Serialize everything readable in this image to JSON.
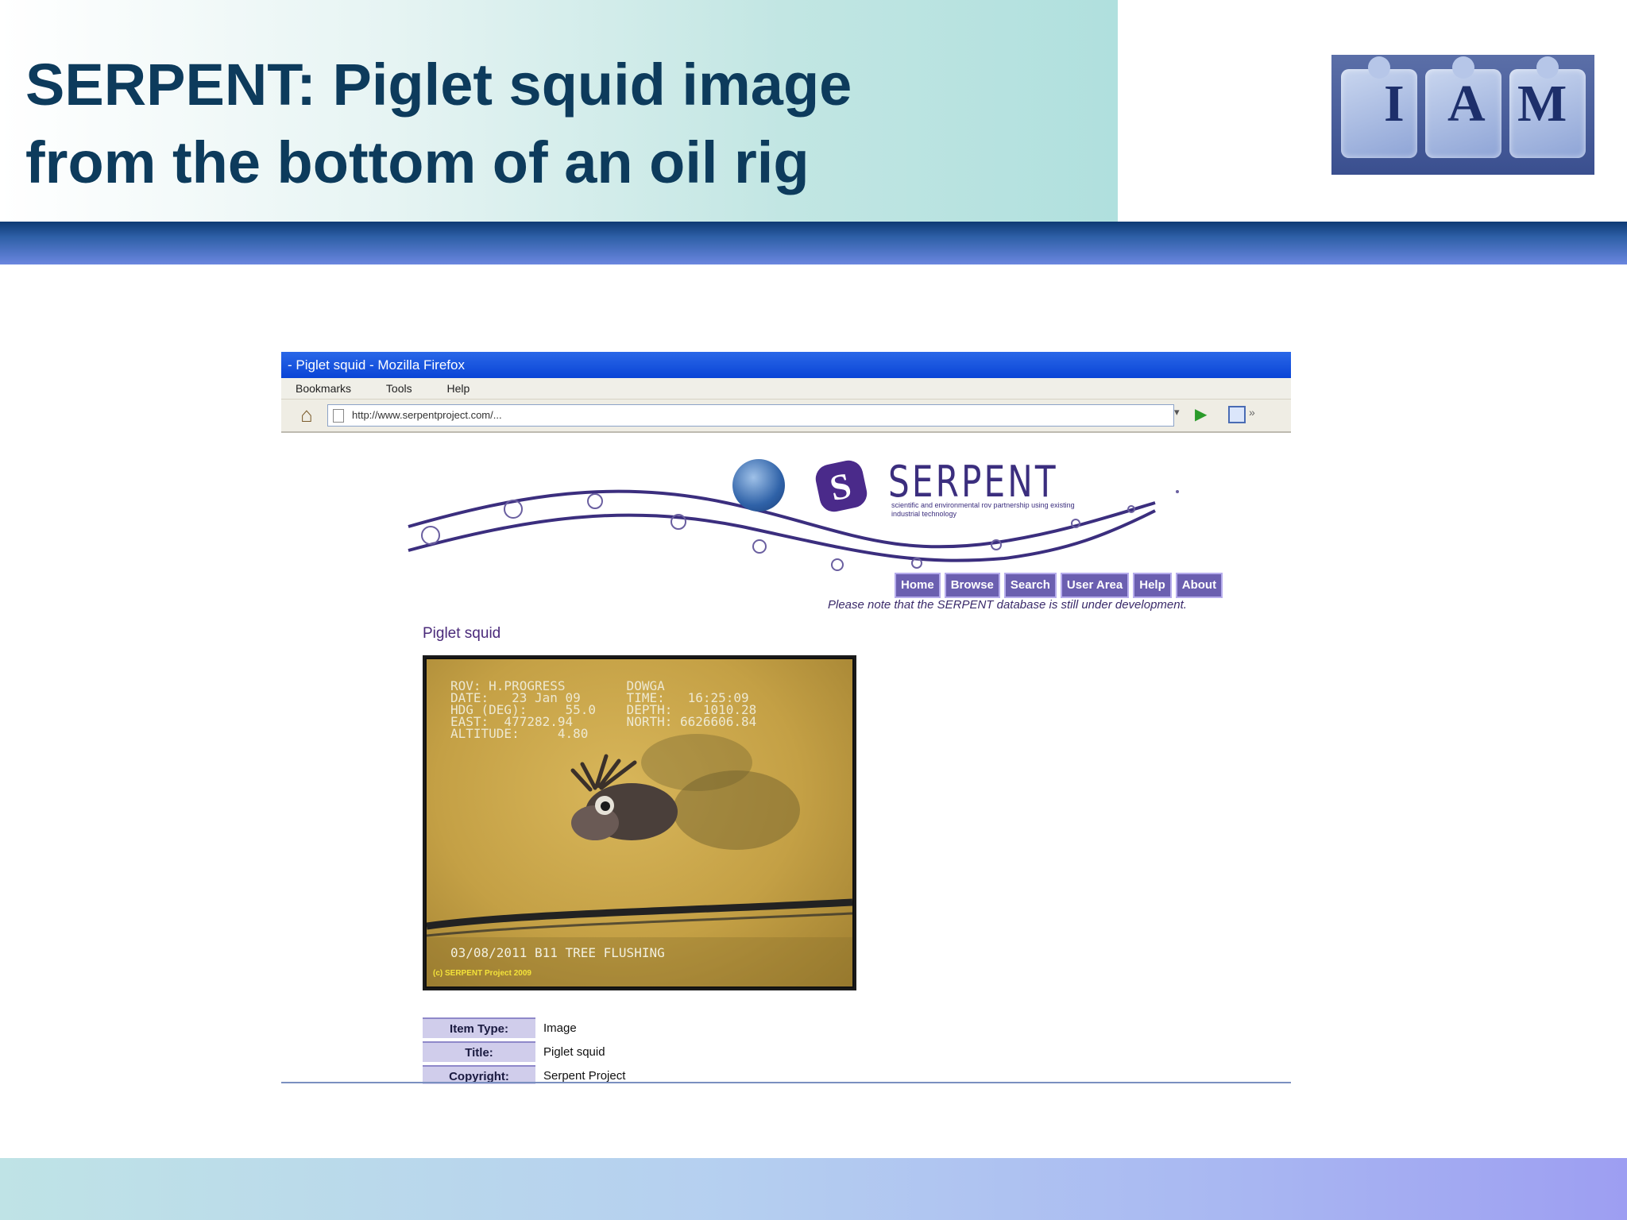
{
  "slide": {
    "title_line1": "SERPENT: Piglet squid image",
    "title_line2": "from the bottom of an oil rig",
    "logo_letters": [
      "I",
      "A",
      "M"
    ]
  },
  "browser": {
    "window_title": "- Piglet squid - Mozilla Firefox",
    "menu": [
      "Bookmarks",
      "Tools",
      "Help"
    ],
    "url": "http://www.serpentproject.com/..."
  },
  "site": {
    "brand": "SERPENT",
    "tagline": "scientific and environmental rov partnership using existing industrial technology",
    "nav": [
      "Home",
      "Browse",
      "Search",
      "User Area",
      "Help",
      "About"
    ],
    "welcome": "Please note that the SERPENT database is still under development.",
    "heading": "Piglet squid",
    "photo_overlay": {
      "lines": [
        "ROV: H.PROGRESS        DOWGA",
        "DATE:   23 Jan 09      TIME:   16:25:09",
        "HDG (DEG):     55.0    DEPTH:    1010.28",
        "EAST:  477282.94       NORTH: 6626606.84",
        "ALTITUDE:     4.80"
      ],
      "bottom": "03/08/2011 B11 TREE FLUSHING",
      "copyright": "(c) SERPENT Project 2009"
    },
    "metadata": [
      {
        "key": "Item Type:",
        "value": "Image"
      },
      {
        "key": "Title:",
        "value": "Piglet squid"
      },
      {
        "key": "Copyright:",
        "value": "Serpent Project"
      }
    ]
  },
  "colors": {
    "title_text": "#0d3b5c",
    "accent_bar": "#2d5fa6",
    "nav_button": "#6b5fb0"
  }
}
